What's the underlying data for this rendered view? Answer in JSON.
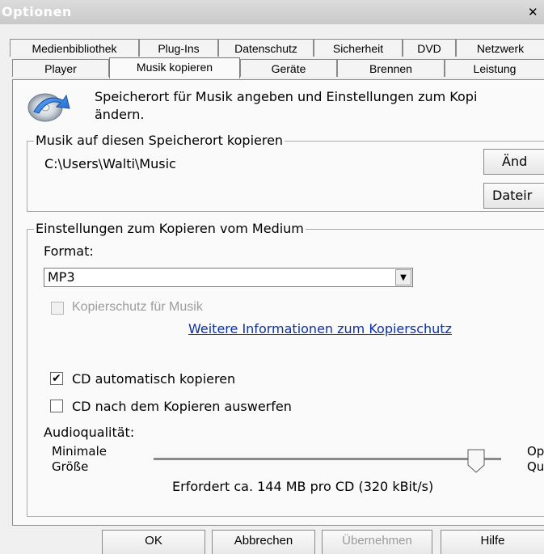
{
  "window": {
    "title": "Optionen"
  },
  "tabs": {
    "top": [
      {
        "label": "Medienbibliothek"
      },
      {
        "label": "Plug-Ins"
      },
      {
        "label": "Datenschutz"
      },
      {
        "label": "Sicherheit"
      },
      {
        "label": "DVD"
      },
      {
        "label": "Netzwerk"
      }
    ],
    "bottom": [
      {
        "label": "Player"
      },
      {
        "label": "Musik kopieren",
        "active": true
      },
      {
        "label": "Geräte"
      },
      {
        "label": "Brennen"
      },
      {
        "label": "Leistung"
      }
    ]
  },
  "header": {
    "line1": "Speicherort für Musik angeben und Einstellungen zum Kopi",
    "line2": "ändern."
  },
  "location_group": {
    "legend": "Musik auf diesen Speicherort kopieren",
    "path": "C:\\Users\\Walti\\Music",
    "change_button": "Änd",
    "filename_button": "Dateir"
  },
  "rip_group": {
    "legend": "Einstellungen zum Kopieren vom Medium",
    "format_label": "Format:",
    "format_value": "MP3",
    "copy_protection_label": "Kopierschutz für Musik",
    "copy_protection_checked": false,
    "more_info_link": "Weitere Informationen zum Kopierschutz",
    "auto_rip_label": "CD automatisch kopieren",
    "auto_rip_checked": true,
    "eject_label": "CD nach dem Kopieren auswerfen",
    "eject_checked": false,
    "audio_quality_label": "Audioqualität:",
    "min_label_line1": "Minimale",
    "min_label_line2": "Größe",
    "max_label_line1": "Op",
    "max_label_line2": "Qu",
    "quality_level": 0.95,
    "required_text": "Erfordert ca. 144 MB pro CD (320 kBit/s)"
  },
  "footer": {
    "ok": "OK",
    "cancel": "Abbrechen",
    "apply": "Übernehmen",
    "help": "Hilfe"
  },
  "icons": {
    "header_icon": "cd-with-arrow-icon"
  },
  "colors": {
    "link": "#0a2fa8",
    "disabled_text": "#9c9c9c"
  }
}
